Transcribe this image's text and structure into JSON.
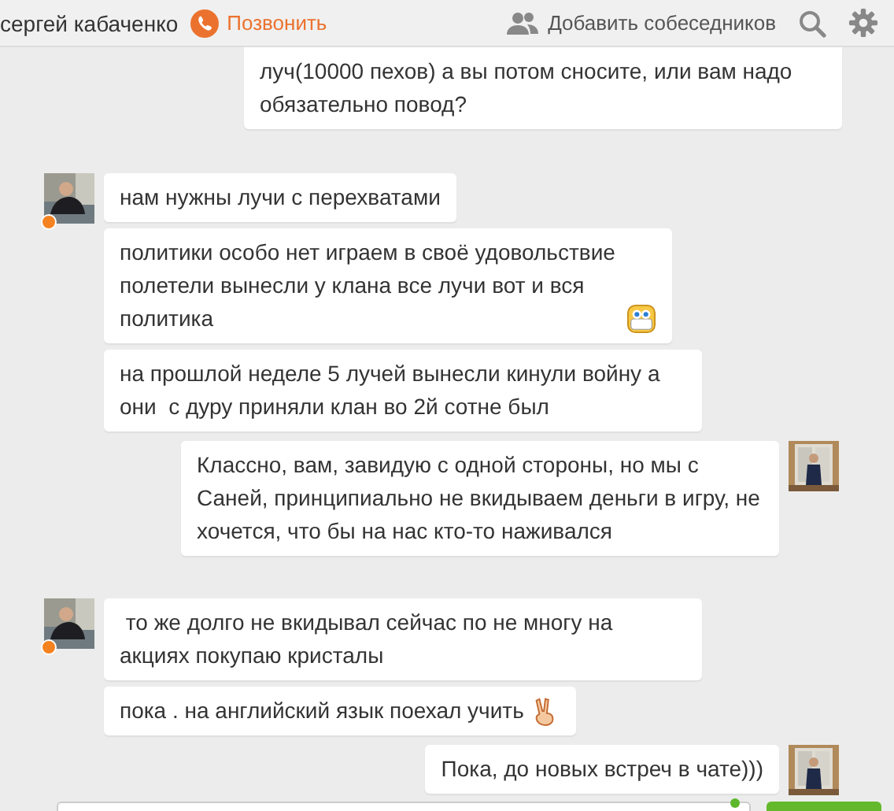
{
  "header": {
    "contact_name": "сергей кабаченко",
    "call_label": "Позвонить",
    "add_label": "Добавить собеседников"
  },
  "groups": [
    {
      "kind": "outgoing",
      "avatar": false,
      "online": false,
      "messages": [
        {
          "kind": "plain",
          "text": "луч(10000 пехов) а вы потом сносите, или вам надо обязательно повод?"
        }
      ]
    },
    {
      "kind": "incoming",
      "avatar": true,
      "online": true,
      "messages": [
        {
          "kind": "plain",
          "text": "нам нужны лучи с перехватами"
        },
        {
          "kind": "grin",
          "text": "политики особо нет играем в своё удовольствие полетели вынесли у клана все лучи вот и вся политика"
        },
        {
          "kind": "plain",
          "text": "на прошлой неделе 5 лучей вынесли кинули войну а они  с дуру приняли клан во 2й сотне был"
        }
      ]
    },
    {
      "kind": "outgoing",
      "avatar": true,
      "online": false,
      "messages": [
        {
          "kind": "plain",
          "text": "Классно, вам, завидую с одной стороны, но мы с Саней, принципиально не вкидываем деньги в игру, не хочется, что бы на нас кто-то наживался"
        }
      ]
    },
    {
      "kind": "incoming",
      "avatar": true,
      "online": true,
      "messages": [
        {
          "kind": "plain",
          "text": " то же долго не вкидывал сейчас по не многу на акциях покупаю кристалы"
        },
        {
          "kind": "victory",
          "text": "пока . на английский язык поехал учить"
        }
      ]
    },
    {
      "kind": "outgoing",
      "avatar": true,
      "online": false,
      "messages": [
        {
          "kind": "plain",
          "text": "Пока, до новых встреч в чате)))"
        }
      ]
    }
  ]
}
